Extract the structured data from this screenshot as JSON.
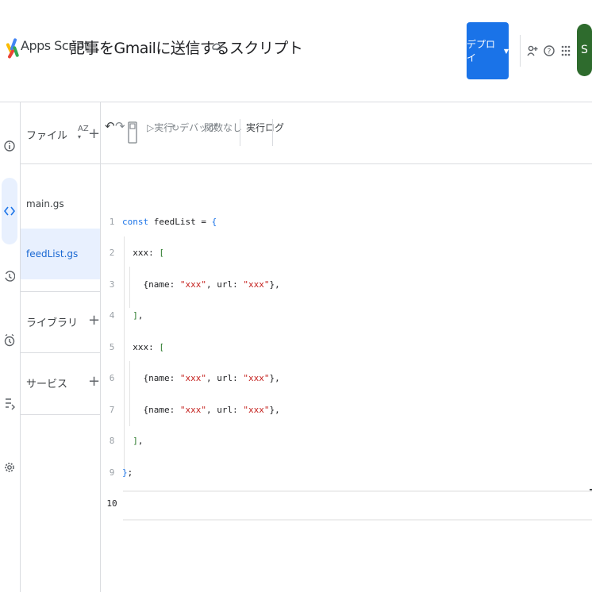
{
  "header": {
    "app_name": "Apps Script",
    "project_title": "記事をGmailに送信するスクリプト",
    "deploy_label": "デプロイ",
    "avatar_letter": "S"
  },
  "files_panel": {
    "files_label": "ファイル",
    "sort_label": "AZ",
    "files": [
      {
        "name": "main.gs",
        "active": false
      },
      {
        "name": "feedList.gs",
        "active": true
      }
    ],
    "libraries_label": "ライブラリ",
    "services_label": "サービス"
  },
  "toolbar": {
    "run_label": "実行",
    "debug_label": "デバッグ",
    "function_label": "関数なし",
    "log_label": "実行ログ"
  },
  "editor": {
    "lines": [
      {
        "n": "1",
        "text": "const feedList = {"
      },
      {
        "n": "2",
        "text": "  xxx: ["
      },
      {
        "n": "3",
        "text": "    {name: \"xxx\", url: \"xxx\"},"
      },
      {
        "n": "4",
        "text": "  ],"
      },
      {
        "n": "5",
        "text": "  xxx: ["
      },
      {
        "n": "6",
        "text": "    {name: \"xxx\", url: \"xxx\"},"
      },
      {
        "n": "7",
        "text": "    {name: \"xxx\", url: \"xxx\"},"
      },
      {
        "n": "8",
        "text": "  ],"
      },
      {
        "n": "9",
        "text": "};"
      },
      {
        "n": "10",
        "text": ""
      }
    ],
    "current_line": "10"
  },
  "colors": {
    "accent": "#1a73e8",
    "active_bg": "#e8f0fe",
    "avatar": "#2e6b2d"
  }
}
